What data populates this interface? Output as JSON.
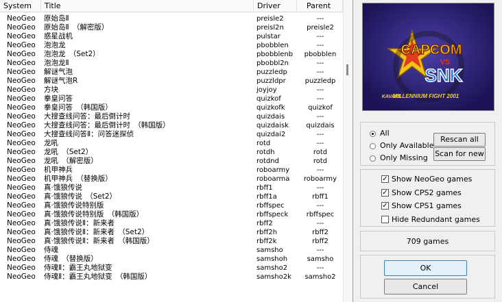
{
  "columns": {
    "system": "System",
    "title": "Title",
    "driver": "Driver",
    "parent": "Parent"
  },
  "rows": [
    {
      "system": "NeoGeo",
      "title": "原始岛Ⅱ",
      "driver": "preisle2",
      "parent": "---"
    },
    {
      "system": "NeoGeo",
      "title": "原始岛Ⅱ　（解密版）",
      "driver": "preisl2n",
      "parent": "preisle2"
    },
    {
      "system": "NeoGeo",
      "title": "惑星战机",
      "driver": "pulstar",
      "parent": "---"
    },
    {
      "system": "NeoGeo",
      "title": "泡泡龙",
      "driver": "pbobblen",
      "parent": "---"
    },
    {
      "system": "NeoGeo",
      "title": "泡泡龙　（Set2）",
      "driver": "pbobblenb",
      "parent": "pbobblen"
    },
    {
      "system": "NeoGeo",
      "title": "泡泡龙Ⅱ",
      "driver": "pbobbl2n",
      "parent": "---"
    },
    {
      "system": "NeoGeo",
      "title": "解谜气泡",
      "driver": "puzzledp",
      "parent": "---"
    },
    {
      "system": "NeoGeo",
      "title": "解谜气泡R",
      "driver": "puzzldpr",
      "parent": "puzzledp"
    },
    {
      "system": "NeoGeo",
      "title": "方块",
      "driver": "joyjoy",
      "parent": "---"
    },
    {
      "system": "NeoGeo",
      "title": "拳皇问答",
      "driver": "quizkof",
      "parent": "---"
    },
    {
      "system": "NeoGeo",
      "title": "拳皇问答　（韩国版）",
      "driver": "quizkofk",
      "parent": "quizkof"
    },
    {
      "system": "NeoGeo",
      "title": "大搜查线问答：最后倒计时",
      "driver": "quizdais",
      "parent": "---"
    },
    {
      "system": "NeoGeo",
      "title": "大搜查线问答：最后倒计时　（韩国版）",
      "driver": "quizdaisk",
      "parent": "quizdais"
    },
    {
      "system": "NeoGeo",
      "title": "大搜查线问答Ⅱ：问答迷探侦",
      "driver": "quizdai2",
      "parent": "---"
    },
    {
      "system": "NeoGeo",
      "title": "龙吼",
      "driver": "rotd",
      "parent": "---"
    },
    {
      "system": "NeoGeo",
      "title": "龙吼　（Set2）",
      "driver": "rotdh",
      "parent": "rotd"
    },
    {
      "system": "NeoGeo",
      "title": "龙吼　（解密版）",
      "driver": "rotdnd",
      "parent": "rotd"
    },
    {
      "system": "NeoGeo",
      "title": "机甲神兵",
      "driver": "roboarmy",
      "parent": "---"
    },
    {
      "system": "NeoGeo",
      "title": "机甲神兵　（替换版）",
      "driver": "roboarma",
      "parent": "roboarmy"
    },
    {
      "system": "NeoGeo",
      "title": "真·饿狼传说",
      "driver": "rbff1",
      "parent": "---"
    },
    {
      "system": "NeoGeo",
      "title": "真·饿狼传说　（Set2）",
      "driver": "rbff1a",
      "parent": "rbff1"
    },
    {
      "system": "NeoGeo",
      "title": "真·饿狼传说特别版",
      "driver": "rbffspec",
      "parent": "---"
    },
    {
      "system": "NeoGeo",
      "title": "真·饿狼传说特别版　（韩国版）",
      "driver": "rbffspeck",
      "parent": "rbffspec"
    },
    {
      "system": "NeoGeo",
      "title": "真·饿狼传说Ⅱ：新来者",
      "driver": "rbff2",
      "parent": "---"
    },
    {
      "system": "NeoGeo",
      "title": "真·饿狼传说Ⅱ：新来者　（Set2）",
      "driver": "rbff2h",
      "parent": "rbff2"
    },
    {
      "system": "NeoGeo",
      "title": "真·饿狼传说Ⅱ：新来者　（韩国版）",
      "driver": "rbff2k",
      "parent": "rbff2"
    },
    {
      "system": "NeoGeo",
      "title": "侍魂",
      "driver": "samsho",
      "parent": "---"
    },
    {
      "system": "NeoGeo",
      "title": "侍魂　（替换版）",
      "driver": "samshoh",
      "parent": "samsho"
    },
    {
      "system": "NeoGeo",
      "title": "侍魂Ⅱ：霸王丸地狱变",
      "driver": "samsho2",
      "parent": "---"
    },
    {
      "system": "NeoGeo",
      "title": "侍魂Ⅱ：霸王丸地狱变　（韩国版）",
      "driver": "samsho2k",
      "parent": "samsho2"
    }
  ],
  "preview": {
    "brand_top": "CAPCOM",
    "brand_vs": "VS",
    "brand_bottom": "SNK",
    "subtitle": "MILLENNIUM FIGHT 2001",
    "maker": "KAVAKS"
  },
  "filter": {
    "options": [
      "All",
      "Only Available",
      "Only Missing"
    ],
    "selected": "All",
    "rescan_label": "Rescan all",
    "scan_new_label": "Scan for new"
  },
  "systems": [
    {
      "label": "Show NeoGeo games",
      "checked": true
    },
    {
      "label": "Show CPS2 games",
      "checked": true
    },
    {
      "label": "Show CPS1 games",
      "checked": true
    },
    {
      "label": "Hide Redundant games",
      "checked": false
    }
  ],
  "count_text": "709 games",
  "ok_label": "OK",
  "cancel_label": "Cancel"
}
